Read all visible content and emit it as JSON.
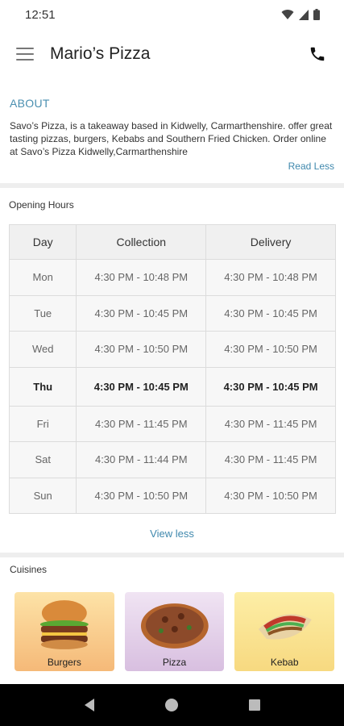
{
  "status_bar": {
    "time": "12:51"
  },
  "app_bar": {
    "title": "Mario’s Pizza"
  },
  "about": {
    "heading": "ABOUT",
    "text": "Savo’s Pizza, is a takeaway based in Kidwelly, Carmarthenshire. offer great tasting pizzas, burgers, Kebabs and Southern Fried Chicken. Order online at Savo’s Pizza Kidwelly,Carmarthenshire",
    "read_less": "Read Less"
  },
  "opening_hours": {
    "title": "Opening Hours",
    "headers": [
      "Day",
      "Collection",
      "Delivery"
    ],
    "rows": [
      {
        "day": "Mon",
        "collection": "4:30 PM - 10:48 PM",
        "delivery": "4:30 PM - 10:48 PM"
      },
      {
        "day": "Tue",
        "collection": "4:30 PM - 10:45 PM",
        "delivery": "4:30 PM - 10:45 PM"
      },
      {
        "day": "Wed",
        "collection": "4:30 PM - 10:50 PM",
        "delivery": "4:30 PM - 10:50 PM"
      },
      {
        "day": "Thu",
        "collection": "4:30 PM - 10:45 PM",
        "delivery": "4:30 PM - 10:45 PM"
      },
      {
        "day": "Fri",
        "collection": "4:30 PM - 11:45 PM",
        "delivery": "4:30 PM - 11:45 PM"
      },
      {
        "day": "Sat",
        "collection": "4:30 PM - 11:44 PM",
        "delivery": "4:30 PM - 11:45 PM"
      },
      {
        "day": "Sun",
        "collection": "4:30 PM - 10:50 PM",
        "delivery": "4:30 PM - 10:50 PM"
      }
    ],
    "view_less": "View less"
  },
  "cuisines": {
    "title": "Cuisines",
    "items": [
      {
        "label": "Burgers"
      },
      {
        "label": "Pizza"
      },
      {
        "label": "Kebab"
      }
    ]
  },
  "colors": {
    "accent": "#3f88ad",
    "divider": "#eeeeee"
  }
}
